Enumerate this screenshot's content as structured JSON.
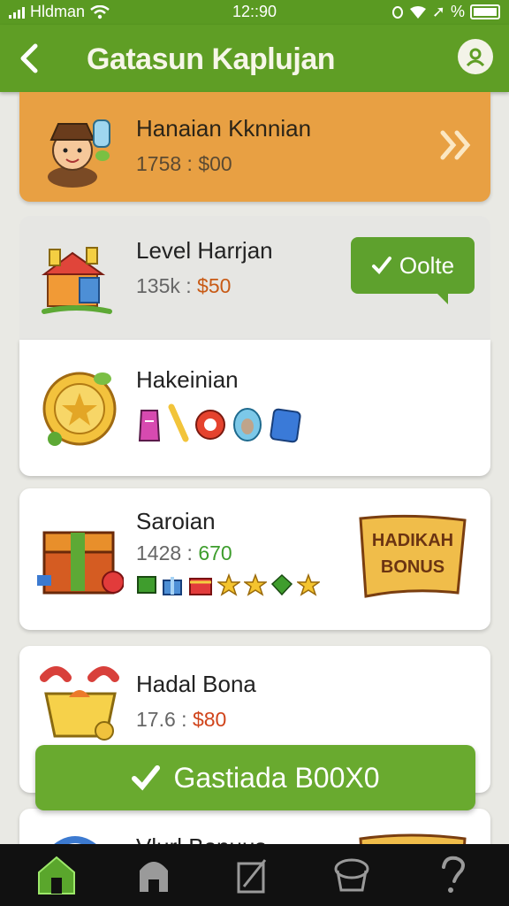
{
  "status": {
    "carrier": "Hldman",
    "time": "12::90",
    "battery": "%"
  },
  "header": {
    "title": "Gatasun Kaplujan",
    "back_icon": "chevron-left-icon",
    "profile_icon": "profile-icon"
  },
  "cards": [
    {
      "name": "Hanaian Kknnian",
      "value": "1758 : $00",
      "action_icon": "double-chevron-right-icon"
    },
    {
      "name": "Level Harrjan",
      "value_prefix": "135k : ",
      "value_amount": "$50",
      "button_label": "Oolte"
    },
    {
      "name": "Hakeinian"
    },
    {
      "name": "Saroian",
      "value_prefix": "1428 : ",
      "value_amount": "670",
      "ribbon_line1": "HADIKAH",
      "ribbon_line2": "BONUS"
    },
    {
      "name": "Hadal Bona",
      "value_prefix": "17.6 : ",
      "value_amount": "$80"
    },
    {
      "name": "Vlurl Bonuus"
    }
  ],
  "cta": {
    "label": "Gastiada B00X0"
  },
  "nav": {
    "items": [
      "home-icon",
      "store-icon",
      "edit-icon",
      "basket-icon",
      "help-icon"
    ]
  },
  "colors": {
    "green": "#5f9e25",
    "orange": "#e8a043",
    "card": "#ffffff"
  }
}
